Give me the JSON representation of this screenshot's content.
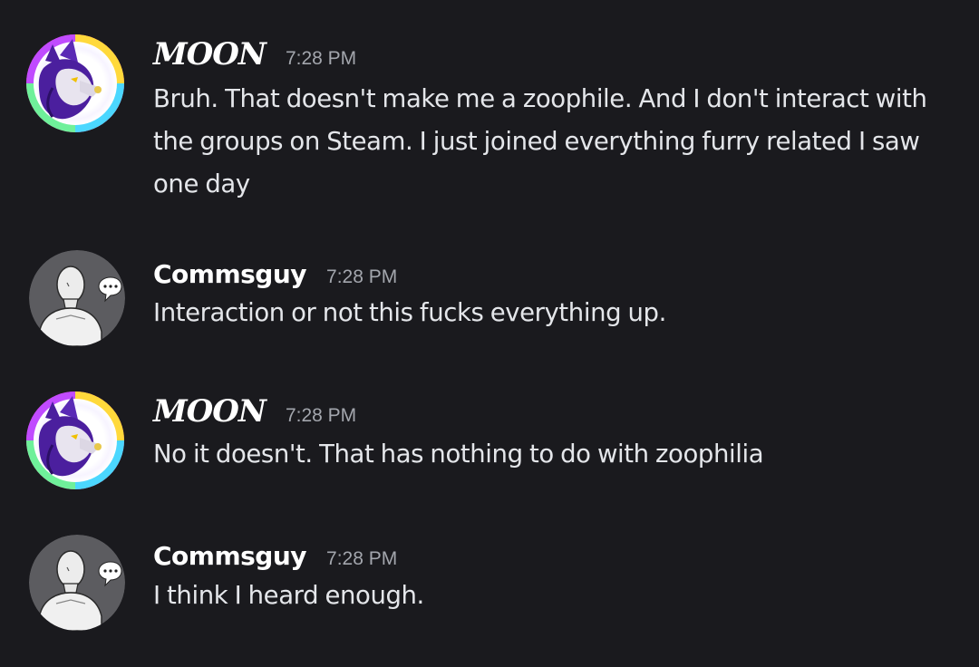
{
  "messages": [
    {
      "author": "MOON",
      "time": "7:28 PM",
      "avatar": "wolf-avatar",
      "ring": "rainbow",
      "text": "Bruh. That doesn't make me a zoophile. And I don't interact with the groups on Steam. I just joined everything furry related I saw one day"
    },
    {
      "author": "Commsguy",
      "time": "7:28 PM",
      "avatar": "mannequin-avatar",
      "text": "Interaction or not this fucks everything up."
    },
    {
      "author": "MOON",
      "time": "7:28 PM",
      "avatar": "wolf-avatar",
      "ring": "rainbow",
      "text": "No it doesn't. That has nothing to do with zoophilia"
    },
    {
      "author": "Commsguy",
      "time": "7:28 PM",
      "avatar": "mannequin-avatar",
      "text": "I think I heard enough."
    }
  ],
  "colors": {
    "background": "#1a1a1e",
    "username": "#ffffff",
    "timestamp": "#a3a6ad",
    "message_text": "#e4e6ea",
    "wolf_fur": "#4b1f9e"
  }
}
